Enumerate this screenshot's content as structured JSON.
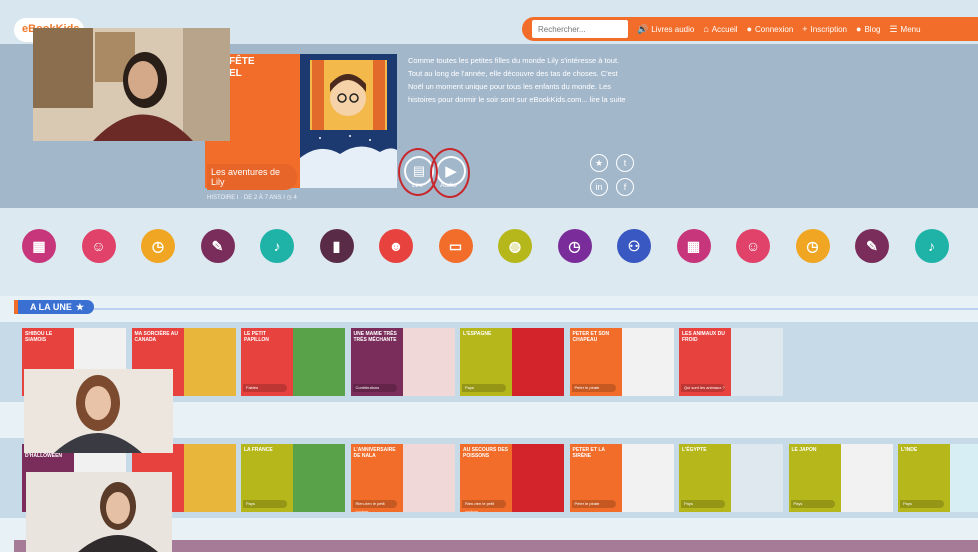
{
  "header": {
    "logo": "eBookKids",
    "search_placeholder": "Rechercher...",
    "nav": [
      {
        "label": "Livres audio",
        "icon": "speaker-icon"
      },
      {
        "label": "Accueil",
        "icon": "home-icon"
      },
      {
        "label": "Connexion",
        "icon": "user-icon"
      },
      {
        "label": "Inscription",
        "icon": "user-plus-icon"
      },
      {
        "label": "Blog",
        "icon": "chat-icon"
      },
      {
        "label": "Menu",
        "icon": "menu-icon"
      }
    ]
  },
  "hero": {
    "title_fragment": "FÊTE\nEL",
    "caption": "Les aventures de Lily",
    "meta": "HISTOIRE I · DE 2 À 7 ANS I ◷ 4",
    "description": "Comme toutes les petites filles du monde Lily s'intéresse à tout. Tout au long de l'année, elle découvre des tas de choses. C'est Noël un moment unique pour tous les enfants du monde. Les histoires pour dormir le soir sont sur eBookKids.com... lire la suite",
    "read_label": "Lire",
    "audio_label": "Audio"
  },
  "section": {
    "label": "A LA UNE"
  },
  "row1": [
    {
      "title": "SHIBOU LE SIAMOIS",
      "tag": "",
      "color": "#e8423f"
    },
    {
      "title": "MA SORCIÈRE AU CANADA",
      "tag": "",
      "color": "#e8423f"
    },
    {
      "title": "LE PETIT PAPILLON",
      "tag": "Fables",
      "color": "#e8423f"
    },
    {
      "title": "UNE MAMIE TRÈS TRÈS MÉCHANTE",
      "tag": "Contributions",
      "color": "#7a2d5a"
    },
    {
      "title": "L'ESPAGNE",
      "tag": "Pays",
      "color": "#b6b71b"
    },
    {
      "title": "PETER ET SON CHAPEAU",
      "tag": "Peter le pirate",
      "color": "#f26d2a"
    },
    {
      "title": "LES ANIMAUX DU FROID",
      "tag": "Qui sont les animaux ?",
      "color": "#e8423f"
    }
  ],
  "row2": [
    {
      "title": "TERRESTRE D'HALLOWEEN",
      "tag": "",
      "color": "#7a2d5a"
    },
    {
      "title": "FROID",
      "tag": "",
      "color": "#e8423f"
    },
    {
      "title": "LA FRANCE",
      "tag": "Pays",
      "color": "#b6b71b"
    },
    {
      "title": "L'ANNIVERSAIRE DE NALA",
      "tag": "Rien-rien le petit cochon",
      "color": "#f26d2a"
    },
    {
      "title": "AU SECOURS DES POISSONS",
      "tag": "Rien-rien le petit cochon",
      "color": "#f26d2a"
    },
    {
      "title": "PETER ET LA SIRÈNE",
      "tag": "Peter le pirate",
      "color": "#f26d2a"
    },
    {
      "title": "L'ÉGYPTE",
      "tag": "Pays",
      "color": "#b6b71b"
    },
    {
      "title": "LE JAPON",
      "tag": "Pays",
      "color": "#b6b71b"
    },
    {
      "title": "L'INDE",
      "tag": "Pays",
      "color": "#b6b71b"
    }
  ],
  "categories": [
    {
      "icon": "abc-blocks-icon",
      "color": "#c7367a"
    },
    {
      "icon": "girl-face-icon",
      "color": "#e0426a"
    },
    {
      "icon": "clock-icon",
      "color": "#f0a623"
    },
    {
      "icon": "pen-icon",
      "color": "#7a2d5a"
    },
    {
      "icon": "microphone-icon",
      "color": "#1fb3a8"
    },
    {
      "icon": "book-icon",
      "color": "#5a2b46"
    },
    {
      "icon": "monkey-icon",
      "color": "#e8423f"
    },
    {
      "icon": "tablet-icon",
      "color": "#f26d2a"
    },
    {
      "icon": "globe-icon",
      "color": "#b6b71b"
    },
    {
      "icon": "clock-icon",
      "color": "#7a2d9a"
    },
    {
      "icon": "group-icon",
      "color": "#3a58c2"
    },
    {
      "icon": "abc-blocks-icon",
      "color": "#c7367a"
    },
    {
      "icon": "girl-face-icon",
      "color": "#e0426a"
    },
    {
      "icon": "clock-icon",
      "color": "#f0a623"
    },
    {
      "icon": "pen-icon",
      "color": "#7a2d5a"
    },
    {
      "icon": "microphone-icon",
      "color": "#1fb3a8"
    }
  ]
}
